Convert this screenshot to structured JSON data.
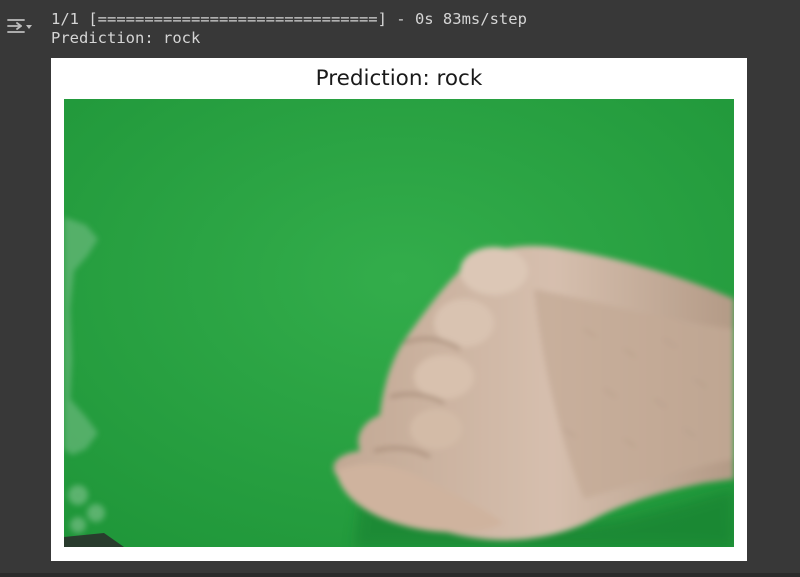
{
  "cell_output": {
    "icon": "output-toggle-icon",
    "progress_line": "1/1 [==============================] - 0s 83ms/step",
    "prediction_line": "Prediction: rock"
  },
  "figure": {
    "title": "Prediction: rock",
    "image_subject": "hand-fist-on-green-background",
    "colors": {
      "background": "#2aa142",
      "skin": "#d0b6a2"
    }
  }
}
